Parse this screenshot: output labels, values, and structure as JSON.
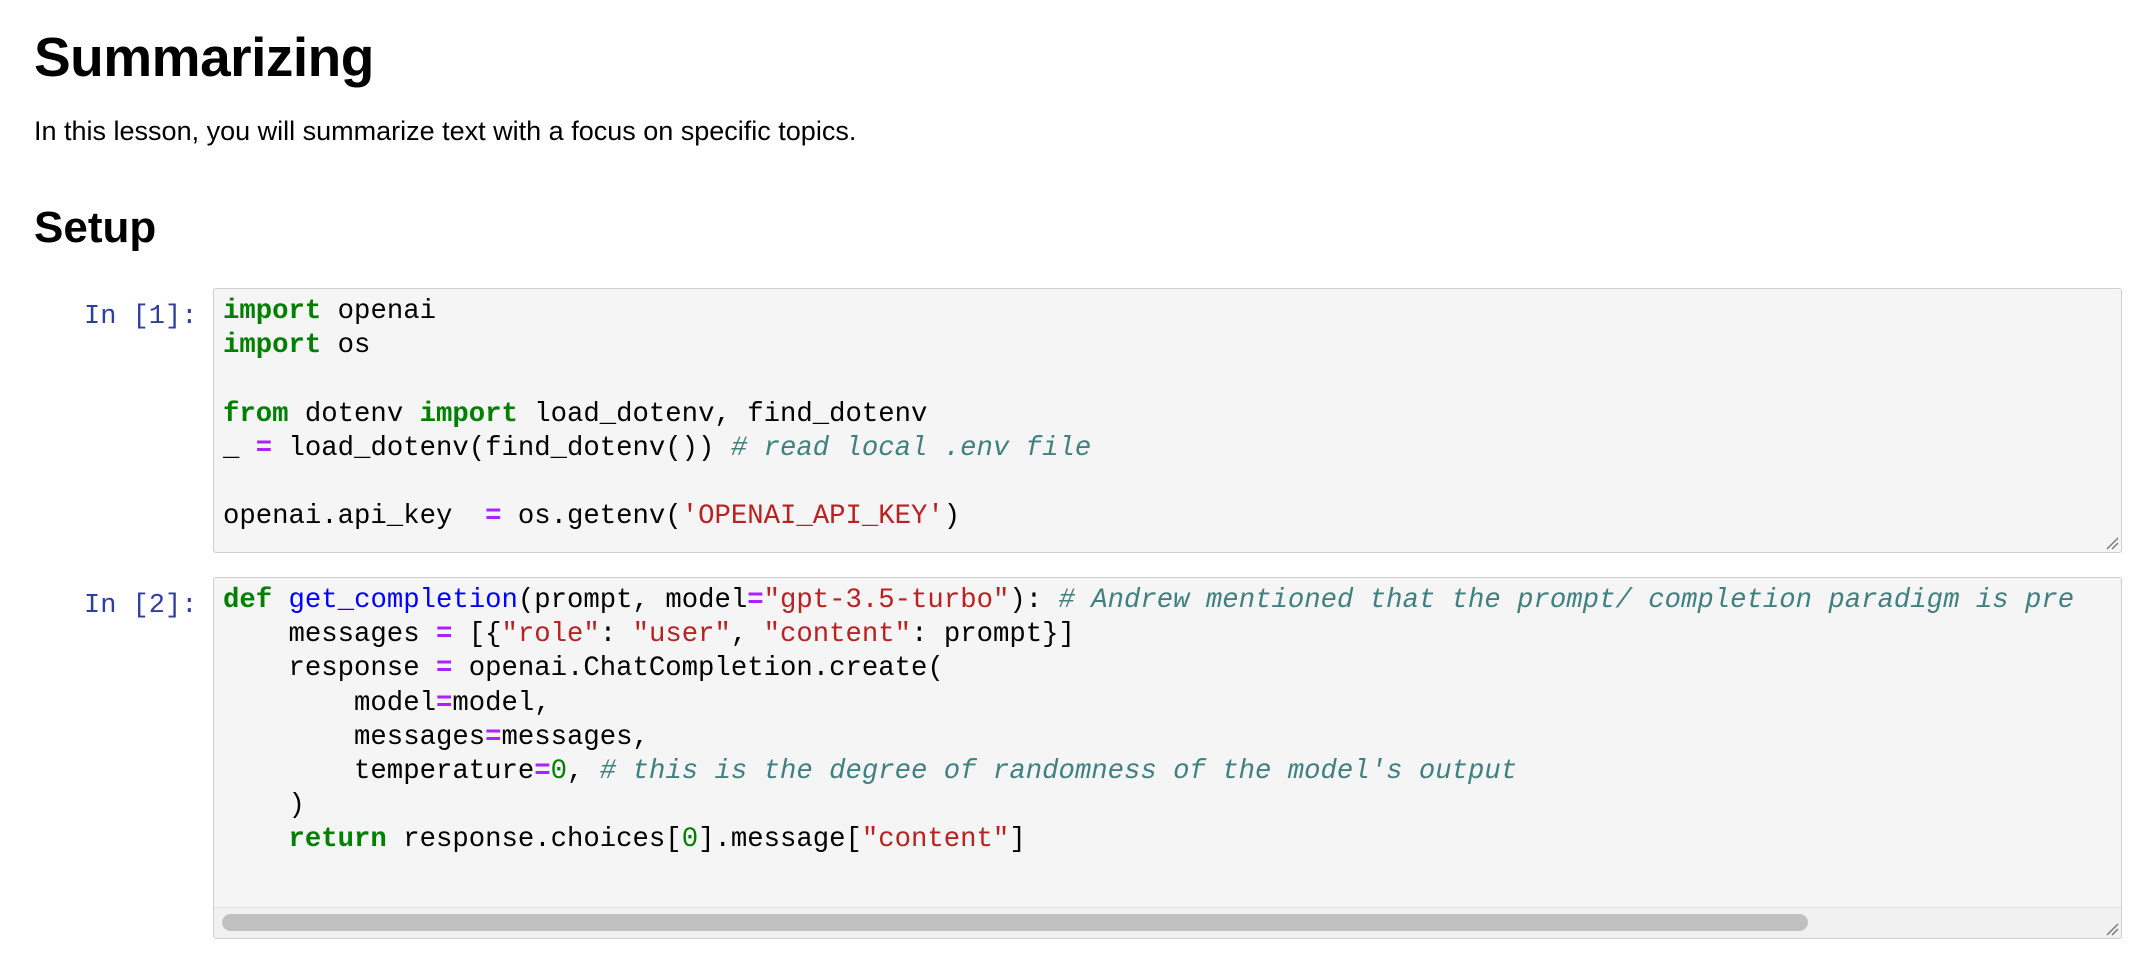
{
  "notebook": {
    "title": "Summarizing",
    "intro": "In this lesson, you will summarize text with a focus on specific topics.",
    "section_setup": "Setup"
  },
  "cells": [
    {
      "prompt": "In [1]:",
      "lines": {
        "l1_kw": "import",
        "l1_rest": " openai",
        "l2_kw": "import",
        "l2_rest": " os",
        "l4_kw1": "from",
        "l4_mid": " dotenv ",
        "l4_kw2": "import",
        "l4_rest": " load_dotenv, find_dotenv",
        "l5_a": "_ ",
        "l5_op": "=",
        "l5_b": " load_dotenv(find_dotenv()) ",
        "l5_cm": "# read local .env file",
        "l7_a": "openai.api_key  ",
        "l7_op": "=",
        "l7_b": " os.getenv(",
        "l7_str": "'OPENAI_API_KEY'",
        "l7_c": ")"
      }
    },
    {
      "prompt": "In [2]:",
      "lines": {
        "l1_kw": "def",
        "l1_sp": " ",
        "l1_fn": "get_completion",
        "l1_a": "(prompt, model",
        "l1_op": "=",
        "l1_str": "\"gpt-3.5-turbo\"",
        "l1_b": "): ",
        "l1_cm": "# Andrew mentioned that the prompt/ completion paradigm is pre",
        "l2_a": "    messages ",
        "l2_op": "=",
        "l2_b": " [{",
        "l2_s1": "\"role\"",
        "l2_c": ": ",
        "l2_s2": "\"user\"",
        "l2_d": ", ",
        "l2_s3": "\"content\"",
        "l2_e": ": prompt}]",
        "l3_a": "    response ",
        "l3_op": "=",
        "l3_b": " openai.ChatCompletion.create(",
        "l4_a": "        model",
        "l4_op": "=",
        "l4_b": "model,",
        "l5_a": "        messages",
        "l5_op": "=",
        "l5_b": "messages,",
        "l6_a": "        temperature",
        "l6_op": "=",
        "l6_num": "0",
        "l6_b": ", ",
        "l6_cm": "# this is the degree of randomness of the model's output",
        "l7_a": "    )",
        "l8_ind": "    ",
        "l8_kw": "return",
        "l8_a": " response.choices[",
        "l8_num": "0",
        "l8_b": "].message[",
        "l8_str": "\"content\"",
        "l8_c": "]"
      }
    }
  ],
  "colors": {
    "prompt": "#303f9f",
    "keyword": "#008000",
    "operator": "#aa22ff",
    "string": "#ba2121",
    "comment": "#408080",
    "function": "#0000ff",
    "cell_bg": "#f5f5f5"
  },
  "icons": [
    "resize-handle-icon",
    "resize-handle-icon"
  ]
}
